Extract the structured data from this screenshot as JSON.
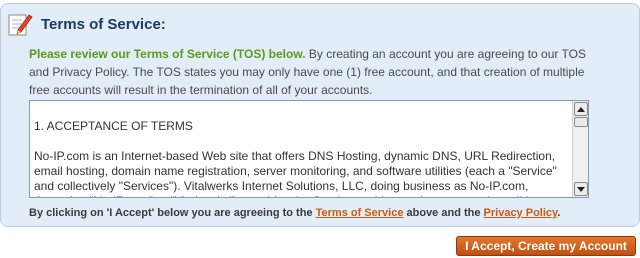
{
  "panel": {
    "title": "Terms of Service:",
    "icon": "pencil-note-icon",
    "intro_lead": "Please review our Terms of Service (TOS) below.",
    "intro_rest": " By creating an account you are agreeing to our TOS and Privacy Policy. The TOS states you may only have one (1) free account, and that creation of multiple free accounts will result in the termination of all of your accounts."
  },
  "tos_box": {
    "heading": "1. ACCEPTANCE OF TERMS",
    "body": "No-IP.com is an Internet-based Web site that offers DNS Hosting, dynamic DNS, URL Redirection, email hosting, domain name registration, server monitoring, and software utilities (each a \"Service\" and collectively \"Services\"). Vitalwerks Internet Solutions, LLC, doing business as No-IP.com, (hereafter \"No-IP.com\" or \"Vitalwerks\"), provides the Services subject to the terms and conditions"
  },
  "accept_note": {
    "before": "By clicking on 'I Accept' below you are agreeing to the ",
    "tos_link": "Terms of Service",
    "middle": " above and the ",
    "privacy_link": "Privacy Policy",
    "after": "."
  },
  "accept_button": {
    "label": "I Accept, Create my Account"
  },
  "colors": {
    "panel_bg": "#e3edf8",
    "title": "#1a3a66",
    "lead_green": "#5a9a1a",
    "link_orange": "#c85a12",
    "button_orange": "#d2631c"
  }
}
